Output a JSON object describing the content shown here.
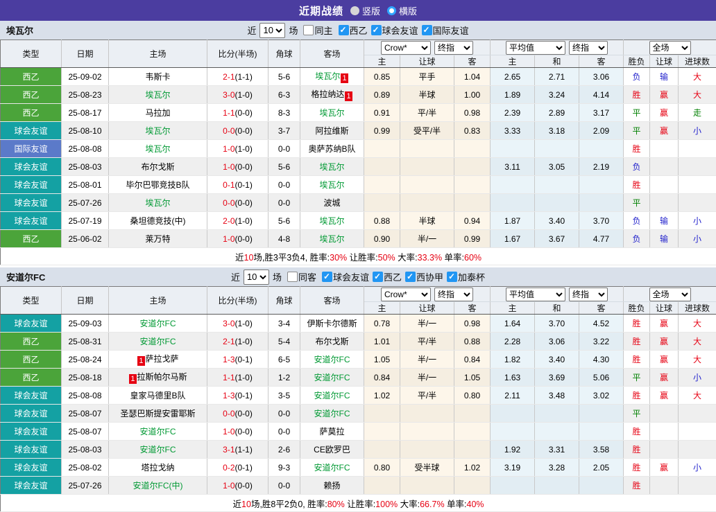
{
  "title_bar": {
    "title": "近期战绩",
    "radios": [
      {
        "label": "竖版",
        "checked": false
      },
      {
        "label": "横版",
        "checked": true
      }
    ]
  },
  "type_colors": {
    "西乙": "#4ba43a",
    "球会友谊": "#14a1a3",
    "国际友谊": "#5b7ac9"
  },
  "sections": [
    {
      "team": "埃瓦尔",
      "filter": {
        "near_label": "近",
        "count": "10",
        "games_label": "场",
        "same_label": "同主",
        "same_checked": false,
        "leagues": [
          {
            "label": "西乙",
            "checked": true
          },
          {
            "label": "球会友谊",
            "checked": true
          },
          {
            "label": "国际友谊",
            "checked": true
          }
        ]
      },
      "selects": {
        "asia1": "Crow*",
        "asia2": "终指",
        "euro1": "平均值",
        "euro2": "终指",
        "full": "全场"
      },
      "columns": {
        "type": "类型",
        "date": "日期",
        "home": "主场",
        "score": "比分(半场)",
        "corner": "角球",
        "away": "客场",
        "asia": [
          "主",
          "让球",
          "客"
        ],
        "euro": [
          "主",
          "和",
          "客"
        ],
        "result": [
          "胜负",
          "让球",
          "进球数"
        ]
      },
      "rows": [
        {
          "type": "西乙",
          "date": "25-09-02",
          "home": {
            "text": "韦斯卡"
          },
          "score": "2-1",
          "half": "(1-1)",
          "corner": "5-6",
          "away": {
            "text": "埃瓦尔",
            "green": true,
            "badge": "1"
          },
          "asia": [
            "0.85",
            "平手",
            "1.04"
          ],
          "euro": [
            "2.65",
            "2.71",
            "3.06"
          ],
          "result": [
            [
              "负",
              "b"
            ],
            [
              "输",
              "b"
            ],
            [
              "大",
              "r"
            ]
          ]
        },
        {
          "type": "西乙",
          "date": "25-08-23",
          "home": {
            "text": "埃瓦尔",
            "green": true
          },
          "score": "3-0",
          "half": "(1-0)",
          "corner": "6-3",
          "away": {
            "text": "格拉纳达",
            "badge": "1"
          },
          "asia": [
            "0.89",
            "半球",
            "1.00"
          ],
          "euro": [
            "1.89",
            "3.24",
            "4.14"
          ],
          "result": [
            [
              "胜",
              "r"
            ],
            [
              "赢",
              "r"
            ],
            [
              "大",
              "r"
            ]
          ]
        },
        {
          "type": "西乙",
          "date": "25-08-17",
          "home": {
            "text": "马拉加"
          },
          "score": "1-1",
          "half": "(0-0)",
          "corner": "8-3",
          "away": {
            "text": "埃瓦尔",
            "green": true
          },
          "asia": [
            "0.91",
            "平/半",
            "0.98"
          ],
          "euro": [
            "2.39",
            "2.89",
            "3.17"
          ],
          "result": [
            [
              "平",
              "g"
            ],
            [
              "赢",
              "r"
            ],
            [
              "走",
              "g"
            ]
          ]
        },
        {
          "type": "球会友谊",
          "date": "25-08-10",
          "home": {
            "text": "埃瓦尔",
            "green": true
          },
          "score": "0-0",
          "half": "(0-0)",
          "corner": "3-7",
          "away": {
            "text": "阿拉维斯"
          },
          "asia": [
            "0.99",
            "受平/半",
            "0.83"
          ],
          "euro": [
            "3.33",
            "3.18",
            "2.09"
          ],
          "result": [
            [
              "平",
              "g"
            ],
            [
              "赢",
              "r"
            ],
            [
              "小",
              "b"
            ]
          ]
        },
        {
          "type": "国际友谊",
          "date": "25-08-08",
          "home": {
            "text": "埃瓦尔",
            "green": true
          },
          "score": "1-0",
          "half": "(1-0)",
          "corner": "0-0",
          "away": {
            "text": "奥萨苏纳B队"
          },
          "asia": [
            "",
            "",
            ""
          ],
          "euro": [
            "",
            "",
            ""
          ],
          "result": [
            [
              "胜",
              "r"
            ],
            [
              "",
              ""
            ],
            [
              "",
              ""
            ]
          ]
        },
        {
          "type": "球会友谊",
          "date": "25-08-03",
          "home": {
            "text": "布尔戈斯"
          },
          "score": "1-0",
          "half": "(0-0)",
          "corner": "5-6",
          "away": {
            "text": "埃瓦尔",
            "green": true
          },
          "asia": [
            "",
            "",
            ""
          ],
          "euro": [
            "3.11",
            "3.05",
            "2.19"
          ],
          "result": [
            [
              "负",
              "b"
            ],
            [
              "",
              ""
            ],
            [
              "",
              ""
            ]
          ]
        },
        {
          "type": "球会友谊",
          "date": "25-08-01",
          "home": {
            "text": "毕尔巴鄂竞技B队"
          },
          "score": "0-1",
          "half": "(0-1)",
          "corner": "0-0",
          "away": {
            "text": "埃瓦尔",
            "green": true
          },
          "asia": [
            "",
            "",
            ""
          ],
          "euro": [
            "",
            "",
            ""
          ],
          "result": [
            [
              "胜",
              "r"
            ],
            [
              "",
              ""
            ],
            [
              "",
              ""
            ]
          ]
        },
        {
          "type": "球会友谊",
          "date": "25-07-26",
          "home": {
            "text": "埃瓦尔",
            "green": true
          },
          "score": "0-0",
          "half": "(0-0)",
          "corner": "0-0",
          "away": {
            "text": "波城"
          },
          "asia": [
            "",
            "",
            ""
          ],
          "euro": [
            "",
            "",
            ""
          ],
          "result": [
            [
              "平",
              "g"
            ],
            [
              "",
              ""
            ],
            [
              "",
              ""
            ]
          ]
        },
        {
          "type": "球会友谊",
          "date": "25-07-19",
          "home": {
            "text": "桑坦德竞技(中)"
          },
          "score": "2-0",
          "half": "(1-0)",
          "corner": "5-6",
          "away": {
            "text": "埃瓦尔",
            "green": true
          },
          "asia": [
            "0.88",
            "半球",
            "0.94"
          ],
          "euro": [
            "1.87",
            "3.40",
            "3.70"
          ],
          "result": [
            [
              "负",
              "b"
            ],
            [
              "输",
              "b"
            ],
            [
              "小",
              "b"
            ]
          ]
        },
        {
          "type": "西乙",
          "date": "25-06-02",
          "home": {
            "text": "莱万特"
          },
          "score": "1-0",
          "half": "(0-0)",
          "corner": "4-8",
          "away": {
            "text": "埃瓦尔",
            "green": true
          },
          "asia": [
            "0.90",
            "半/一",
            "0.99"
          ],
          "euro": [
            "1.67",
            "3.67",
            "4.77"
          ],
          "result": [
            [
              "负",
              "b"
            ],
            [
              "输",
              "b"
            ],
            [
              "小",
              "b"
            ]
          ]
        }
      ],
      "summary": [
        [
          "近",
          "n"
        ],
        [
          "10",
          "r"
        ],
        [
          "场,胜3平3负4, 胜率:",
          "n"
        ],
        [
          "30%",
          "r"
        ],
        [
          " 让胜率:",
          "n"
        ],
        [
          "50%",
          "r"
        ],
        [
          " 大率:",
          "n"
        ],
        [
          "33.3%",
          "r"
        ],
        [
          " 单率:",
          "n"
        ],
        [
          "60%",
          "r"
        ]
      ]
    },
    {
      "team": "安道尔FC",
      "filter": {
        "near_label": "近",
        "count": "10",
        "games_label": "场",
        "same_label": "同客",
        "same_checked": false,
        "leagues": [
          {
            "label": "球会友谊",
            "checked": true
          },
          {
            "label": "西乙",
            "checked": true
          },
          {
            "label": "西协甲",
            "checked": true
          },
          {
            "label": "加泰杯",
            "checked": true
          }
        ]
      },
      "selects": {
        "asia1": "Crow*",
        "asia2": "终指",
        "euro1": "平均值",
        "euro2": "终指",
        "full": "全场"
      },
      "columns": {
        "type": "类型",
        "date": "日期",
        "home": "主场",
        "score": "比分(半场)",
        "corner": "角球",
        "away": "客场",
        "asia": [
          "主",
          "让球",
          "客"
        ],
        "euro": [
          "主",
          "和",
          "客"
        ],
        "result": [
          "胜负",
          "让球",
          "进球数"
        ]
      },
      "rows": [
        {
          "type": "球会友谊",
          "date": "25-09-03",
          "home": {
            "text": "安道尔FC",
            "green": true
          },
          "score": "3-0",
          "half": "(1-0)",
          "corner": "3-4",
          "away": {
            "text": "伊斯卡尔德斯"
          },
          "asia": [
            "0.78",
            "半/一",
            "0.98"
          ],
          "euro": [
            "1.64",
            "3.70",
            "4.52"
          ],
          "result": [
            [
              "胜",
              "r"
            ],
            [
              "赢",
              "r"
            ],
            [
              "大",
              "r"
            ]
          ]
        },
        {
          "type": "西乙",
          "date": "25-08-31",
          "home": {
            "text": "安道尔FC",
            "green": true
          },
          "score": "2-1",
          "half": "(1-0)",
          "corner": "5-4",
          "away": {
            "text": "布尔戈斯"
          },
          "asia": [
            "1.01",
            "平/半",
            "0.88"
          ],
          "euro": [
            "2.28",
            "3.06",
            "3.22"
          ],
          "result": [
            [
              "胜",
              "r"
            ],
            [
              "赢",
              "r"
            ],
            [
              "大",
              "r"
            ]
          ]
        },
        {
          "type": "西乙",
          "date": "25-08-24",
          "home": {
            "text": "萨拉戈萨",
            "badge": "1"
          },
          "score": "1-3",
          "half": "(0-1)",
          "corner": "6-5",
          "away": {
            "text": "安道尔FC",
            "green": true
          },
          "asia": [
            "1.05",
            "半/一",
            "0.84"
          ],
          "euro": [
            "1.82",
            "3.40",
            "4.30"
          ],
          "result": [
            [
              "胜",
              "r"
            ],
            [
              "赢",
              "r"
            ],
            [
              "大",
              "r"
            ]
          ]
        },
        {
          "type": "西乙",
          "date": "25-08-18",
          "home": {
            "text": "拉斯帕尔马斯",
            "badge": "1"
          },
          "score": "1-1",
          "half": "(1-0)",
          "corner": "1-2",
          "away": {
            "text": "安道尔FC",
            "green": true
          },
          "asia": [
            "0.84",
            "半/一",
            "1.05"
          ],
          "euro": [
            "1.63",
            "3.69",
            "5.06"
          ],
          "result": [
            [
              "平",
              "g"
            ],
            [
              "赢",
              "r"
            ],
            [
              "小",
              "b"
            ]
          ]
        },
        {
          "type": "球会友谊",
          "date": "25-08-08",
          "home": {
            "text": "皇家马德里B队"
          },
          "score": "1-3",
          "half": "(0-1)",
          "corner": "3-5",
          "away": {
            "text": "安道尔FC",
            "green": true
          },
          "asia": [
            "1.02",
            "平/半",
            "0.80"
          ],
          "euro": [
            "2.11",
            "3.48",
            "3.02"
          ],
          "result": [
            [
              "胜",
              "r"
            ],
            [
              "赢",
              "r"
            ],
            [
              "大",
              "r"
            ]
          ]
        },
        {
          "type": "球会友谊",
          "date": "25-08-07",
          "home": {
            "text": "圣瑟巴斯提安雷耶斯"
          },
          "score": "0-0",
          "half": "(0-0)",
          "corner": "0-0",
          "away": {
            "text": "安道尔FC",
            "green": true
          },
          "asia": [
            "",
            "",
            ""
          ],
          "euro": [
            "",
            "",
            ""
          ],
          "result": [
            [
              "平",
              "g"
            ],
            [
              "",
              ""
            ],
            [
              "",
              ""
            ]
          ]
        },
        {
          "type": "球会友谊",
          "date": "25-08-07",
          "home": {
            "text": "安道尔FC",
            "green": true
          },
          "score": "1-0",
          "half": "(0-0)",
          "corner": "0-0",
          "away": {
            "text": "萨莫拉"
          },
          "asia": [
            "",
            "",
            ""
          ],
          "euro": [
            "",
            "",
            ""
          ],
          "result": [
            [
              "胜",
              "r"
            ],
            [
              "",
              ""
            ],
            [
              "",
              ""
            ]
          ]
        },
        {
          "type": "球会友谊",
          "date": "25-08-03",
          "home": {
            "text": "安道尔FC",
            "green": true
          },
          "score": "3-1",
          "half": "(1-1)",
          "corner": "2-6",
          "away": {
            "text": "CE欧罗巴"
          },
          "asia": [
            "",
            "",
            ""
          ],
          "euro": [
            "1.92",
            "3.31",
            "3.58"
          ],
          "result": [
            [
              "胜",
              "r"
            ],
            [
              "",
              ""
            ],
            [
              "",
              ""
            ]
          ]
        },
        {
          "type": "球会友谊",
          "date": "25-08-02",
          "home": {
            "text": "塔拉戈纳"
          },
          "score": "0-2",
          "half": "(0-1)",
          "corner": "9-3",
          "away": {
            "text": "安道尔FC",
            "green": true
          },
          "asia": [
            "0.80",
            "受半球",
            "1.02"
          ],
          "euro": [
            "3.19",
            "3.28",
            "2.05"
          ],
          "result": [
            [
              "胜",
              "r"
            ],
            [
              "赢",
              "r"
            ],
            [
              "小",
              "b"
            ]
          ]
        },
        {
          "type": "球会友谊",
          "date": "25-07-26",
          "home": {
            "text": "安道尔FC(中)",
            "green": true
          },
          "score": "1-0",
          "half": "(0-0)",
          "corner": "0-0",
          "away": {
            "text": "赖扬"
          },
          "asia": [
            "",
            "",
            ""
          ],
          "euro": [
            "",
            "",
            ""
          ],
          "result": [
            [
              "胜",
              "r"
            ],
            [
              "",
              ""
            ],
            [
              "",
              ""
            ]
          ]
        }
      ],
      "summary": [
        [
          "近",
          "n"
        ],
        [
          "10",
          "r"
        ],
        [
          "场,胜8平2负0, 胜率:",
          "n"
        ],
        [
          "80%",
          "r"
        ],
        [
          " 让胜率:",
          "n"
        ],
        [
          "100%",
          "r"
        ],
        [
          " 大率:",
          "n"
        ],
        [
          "66.7%",
          "r"
        ],
        [
          " 单率:",
          "n"
        ],
        [
          "40%",
          "r"
        ]
      ]
    }
  ]
}
